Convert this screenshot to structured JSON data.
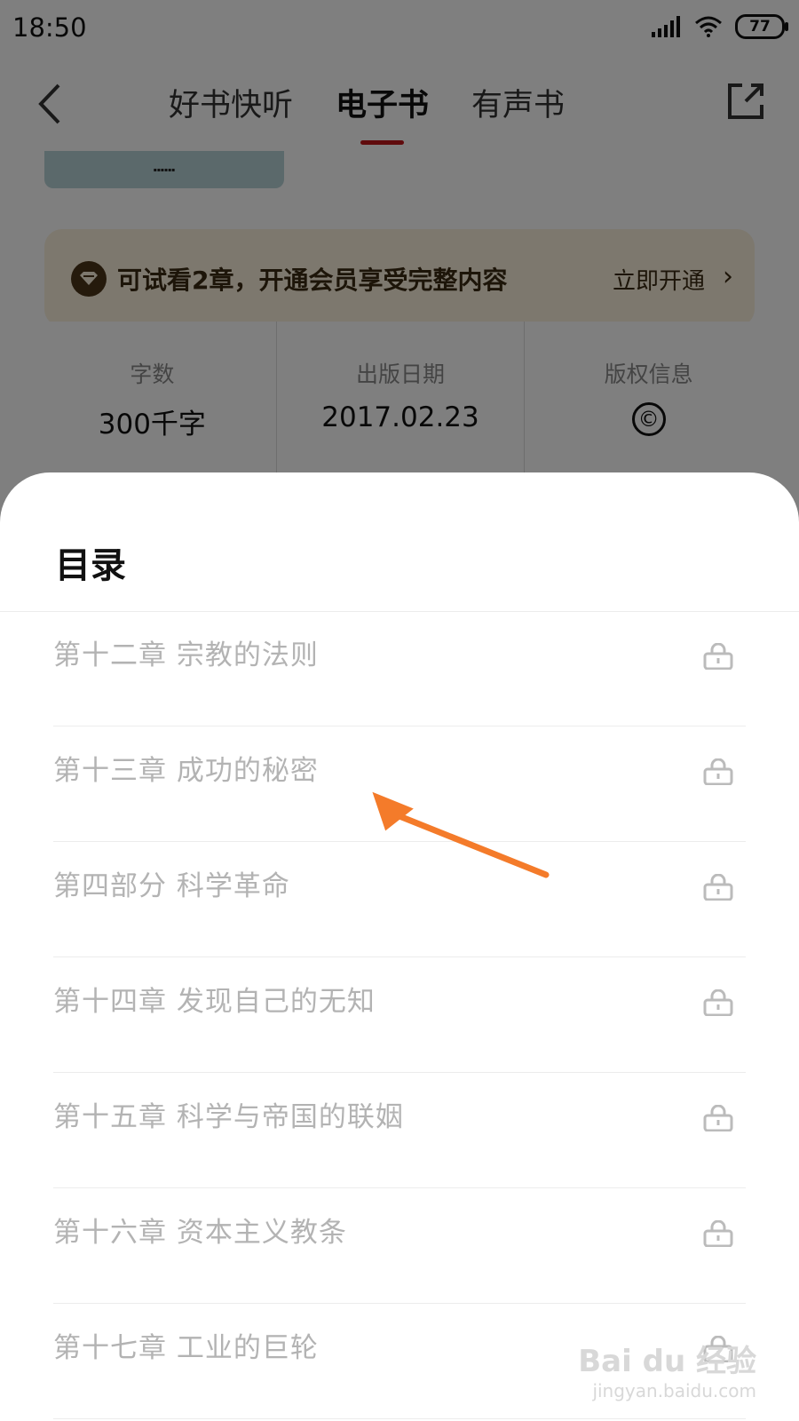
{
  "status_bar": {
    "time": "18:50",
    "battery": "77"
  },
  "header": {
    "tabs": [
      {
        "label": "好书快听",
        "active": false
      },
      {
        "label": "电子书",
        "active": true
      },
      {
        "label": "有声书",
        "active": false
      }
    ]
  },
  "vip_banner": {
    "text": "可试看2章，开通会员享受完整内容",
    "cta": "立即开通"
  },
  "info": {
    "word_count": {
      "label": "字数",
      "value": "300千字"
    },
    "publish_date": {
      "label": "出版日期",
      "value": "2017.02.23"
    },
    "copyright": {
      "label": "版权信息",
      "value": "©"
    }
  },
  "toc": {
    "title": "目录",
    "items": [
      {
        "label": "第十二章 宗教的法则"
      },
      {
        "label": "第十三章 成功的秘密"
      },
      {
        "label": "第四部分 科学革命"
      },
      {
        "label": "第十四章 发现自己的无知"
      },
      {
        "label": "第十五章 科学与帝国的联姻"
      },
      {
        "label": "第十六章 资本主义教条"
      },
      {
        "label": "第十七章 工业的巨轮"
      }
    ]
  },
  "watermark": {
    "main": "Bai du 经验",
    "sub": "jingyan.baidu.com"
  },
  "colors": {
    "accent": "#c0171b",
    "vip_bg": "#fbf0dc",
    "vip_text": "#3a2a12",
    "annotation_arrow": "#f47b2a"
  }
}
